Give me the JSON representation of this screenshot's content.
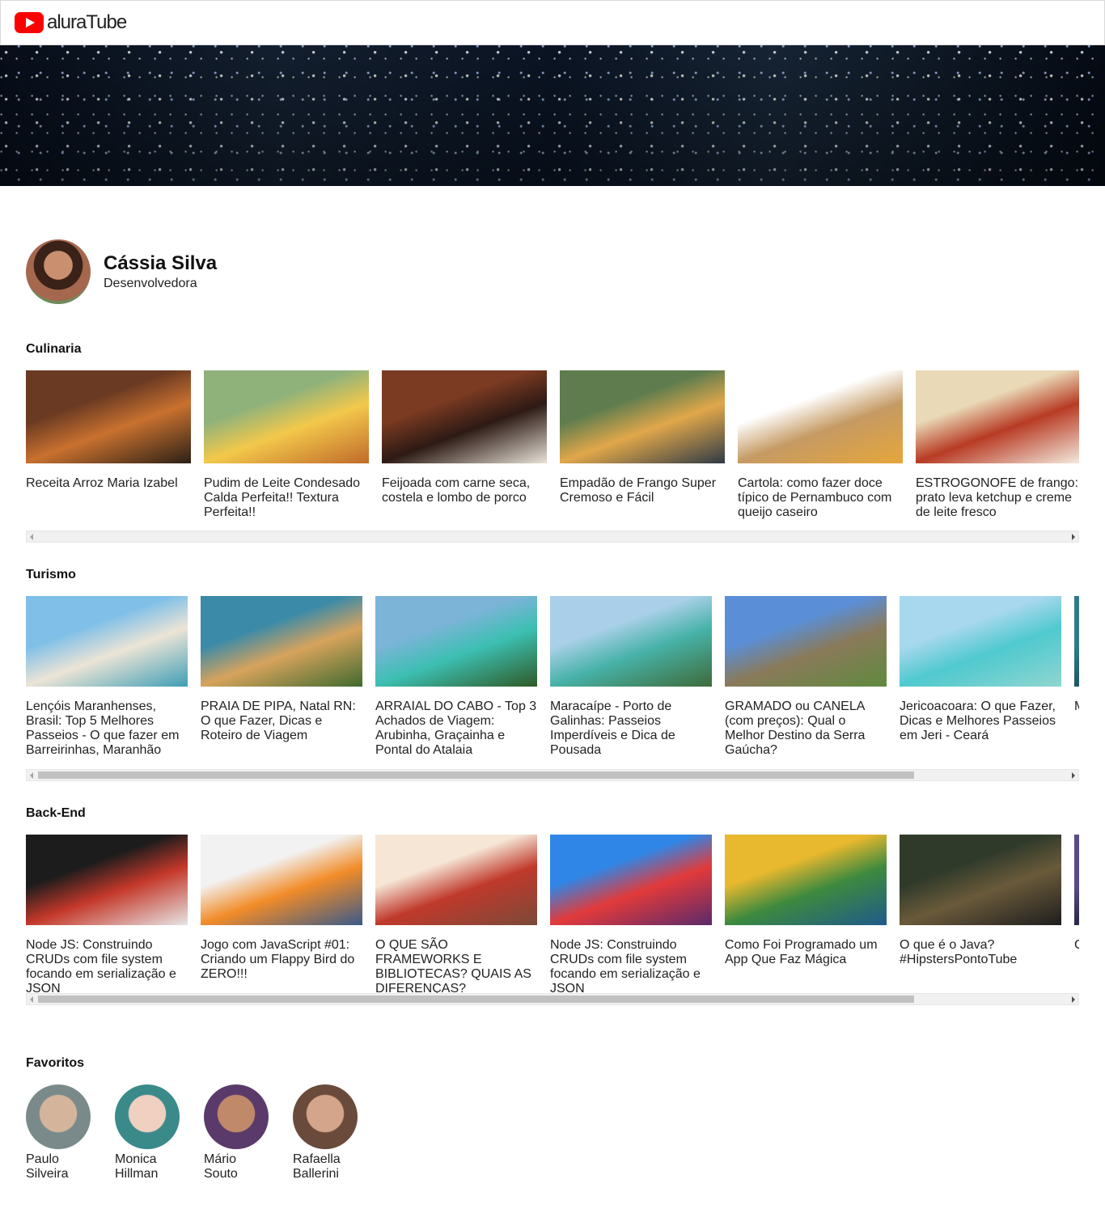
{
  "header": {
    "logo_text": "aluraTube"
  },
  "profile": {
    "name": "Cássia Silva",
    "job": "Desenvolvedora"
  },
  "playlists": [
    {
      "name": "Culinaria",
      "videos": [
        {
          "title": "Receita Arroz Maria Izabel",
          "colors": [
            "#6b3a22",
            "#c9712f",
            "#2b2016"
          ]
        },
        {
          "title": "Pudim de Leite Condesado Calda Perfeita!! Textura Perfeita!!",
          "colors": [
            "#8fb27b",
            "#f3c84b",
            "#c06a2a"
          ]
        },
        {
          "title": "Feijoada com carne seca, costela e lombo de porco",
          "colors": [
            "#7b3a22",
            "#2d1a14",
            "#e8e3d8"
          ]
        },
        {
          "title": "Empadão de Frango Super Cremoso e Fácil",
          "colors": [
            "#5e7c4e",
            "#e1a74a",
            "#2f3a46"
          ]
        },
        {
          "title": "Cartola: como fazer doce típico de Pernambuco com queijo caseiro",
          "colors": [
            "#ffffff",
            "#c59a63",
            "#e6a63a"
          ]
        },
        {
          "title": "ESTROGONOFE de frango: prato leva ketchup e creme de leite fresco",
          "colors": [
            "#e9d9b6",
            "#b83b24",
            "#f4ece0"
          ]
        }
      ]
    },
    {
      "name": "Turismo",
      "videos": [
        {
          "title": "Lençóis Maranhenses, Brasil: Top 5 Melhores Passeios - O que fazer em Barreirinhas, Maranhão",
          "colors": [
            "#7fbfe8",
            "#ece4d6",
            "#3e9eb6"
          ]
        },
        {
          "title": "PRAIA DE PIPA, Natal RN: O que Fazer, Dicas e Roteiro de Viagem",
          "colors": [
            "#3a8aa8",
            "#d7a35c",
            "#3f6a2e"
          ]
        },
        {
          "title": "ARRAIAL DO CABO - Top 3 Achados de Viagem: Arubinha, Graçainha e Pontal do Atalaia",
          "colors": [
            "#7cb4d8",
            "#3cbfb2",
            "#2f5a26"
          ]
        },
        {
          "title": "Maracaípe - Porto de Galinhas: Passeios Imperdíveis e Dica de Pousada",
          "colors": [
            "#a9d0e8",
            "#47b2a8",
            "#3e6b3a"
          ]
        },
        {
          "title": "GRAMADO ou CANELA (com preços): Qual o Melhor Destino da Serra Gaúcha?",
          "colors": [
            "#5a8fd8",
            "#8a7a5a",
            "#5f8a3e"
          ]
        },
        {
          "title": "Jericoacoara: O que Fazer, Dicas e Melhores Passeios em Jeri - Ceará",
          "colors": [
            "#a8d8ee",
            "#4fc9cf",
            "#8fd6d0"
          ]
        },
        {
          "title": "M T P C",
          "colors": [
            "#2f7a8a",
            "#1e5866",
            "#4a9aa8"
          ]
        }
      ]
    },
    {
      "name": "Back-End",
      "videos": [
        {
          "title": "Node JS: Construindo CRUDs com file system focando em serialização e JSON",
          "colors": [
            "#1c1c1c",
            "#c4382a",
            "#e6e6e6"
          ]
        },
        {
          "title": "Jogo com JavaScript #01: Criando um Flappy Bird do ZERO!!!",
          "colors": [
            "#f2f2f2",
            "#f28c28",
            "#3a5a8a"
          ]
        },
        {
          "title": "O QUE SÃO FRAMEWORKS E BIBLIOTECAS? QUAIS AS DIFERENÇAS?",
          "colors": [
            "#f6e6d6",
            "#c0392b",
            "#7a4a3a"
          ]
        },
        {
          "title": "Node JS: Construindo CRUDs com file system focando em serialização e JSON",
          "colors": [
            "#2f86e6",
            "#e23a3a",
            "#5a2a6a"
          ]
        },
        {
          "title": "Como Foi Programado um App Que Faz Mágica",
          "colors": [
            "#e8b82e",
            "#3e8a3e",
            "#1f5a8a"
          ]
        },
        {
          "title": "O que é o Java? #HipstersPontoTube",
          "colors": [
            "#2f3a2a",
            "#6a5a3a",
            "#1e1e1e"
          ]
        },
        {
          "title": "C L #",
          "colors": [
            "#5a4a8a",
            "#2a2a4a",
            "#8a6aaa"
          ]
        }
      ]
    }
  ],
  "favorites": {
    "title": "Favoritos",
    "people": [
      {
        "name": "Paulo Silveira",
        "colors": [
          "#d4b59b",
          "#7a8a8a"
        ]
      },
      {
        "name": "Monica Hillman",
        "colors": [
          "#f0d0c0",
          "#3a8a8a"
        ]
      },
      {
        "name": "Mário Souto",
        "colors": [
          "#c08a6a",
          "#5a3a6a"
        ]
      },
      {
        "name": "Rafaella Ballerini",
        "colors": [
          "#d4a58a",
          "#6a4a3a"
        ]
      }
    ]
  },
  "scrollbars": [
    {
      "thumb_fraction": 0
    },
    {
      "thumb_fraction": 0.85
    },
    {
      "thumb_fraction": 0.85
    }
  ]
}
